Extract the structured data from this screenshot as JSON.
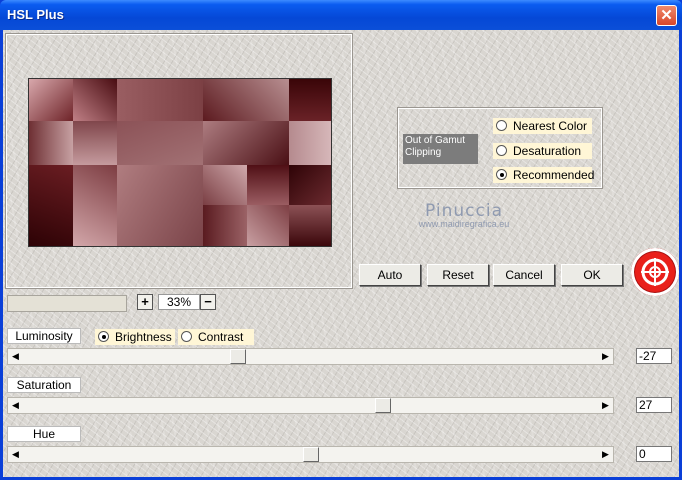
{
  "window": {
    "title": "HSL Plus",
    "close_glyph": "✕"
  },
  "gamut": {
    "label": "Out of Gamut Clipping",
    "options": [
      {
        "label": "Nearest Color",
        "selected": false
      },
      {
        "label": "Desaturation",
        "selected": false
      },
      {
        "label": "Recommended",
        "selected": true
      }
    ]
  },
  "watermark": {
    "line1": "Pinuccia",
    "line2": "www.maidiregrafica.eu"
  },
  "buttons": {
    "auto": "Auto",
    "reset": "Reset",
    "cancel": "Cancel",
    "ok": "OK"
  },
  "zoom": {
    "plus": "+",
    "minus": "−",
    "value": "33%"
  },
  "luminosity": {
    "label": "Luminosity",
    "modes": [
      {
        "label": "Brightness",
        "selected": true
      },
      {
        "label": "Contrast",
        "selected": false
      }
    ],
    "value": "-27",
    "position": 0.37
  },
  "saturation": {
    "label": "Saturation",
    "value": "27",
    "position": 0.63
  },
  "hue": {
    "label": "Hue",
    "value": "0",
    "position": 0.5
  },
  "colors": {
    "title_bar": "#0548d6",
    "dialog_bg": "#d9d6d1",
    "highlight": "#fff6d6",
    "help_red": "#e9201b"
  }
}
